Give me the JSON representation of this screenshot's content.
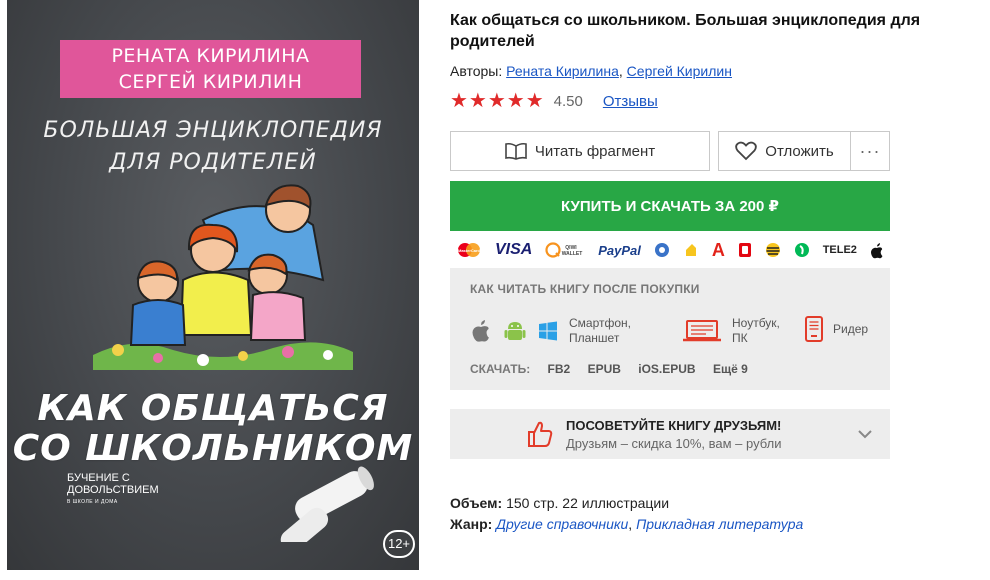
{
  "cover": {
    "author_line_1": "РЕНАТА КИРИЛИНА",
    "author_line_2": "СЕРГЕЙ КИРИЛИН",
    "subtitle_line_1": "БОЛЬШАЯ ЭНЦИКЛОПЕДИЯ",
    "subtitle_line_2": "ДЛЯ РОДИТЕЛЕЙ",
    "title_line_1": "КАК ОБЩАТЬСЯ",
    "title_line_2": "СО ШКОЛЬНИКОМ",
    "series_line_1": "БУЧЕНИЕ С",
    "series_line_2": "ДОВОЛЬСТВИЕМ",
    "series_line_3": "В ШКОЛЕ И ДОМА",
    "age_rating": "12+"
  },
  "book": {
    "title": "Как общаться со школьником. Большая энциклопедия для родителей",
    "authors_label": "Авторы:",
    "author_1": "Рената Кирилина",
    "author_2": "Сергей Кирилин",
    "authors_separator": ",",
    "stars": "★★★★★",
    "rating": "4.50",
    "reviews_label": "Отзывы"
  },
  "actions": {
    "read_fragment": "Читать фрагмент",
    "defer": "Отложить",
    "more": "···",
    "buy": "КУПИТЬ И СКАЧАТЬ ЗА 200 ₽"
  },
  "payments": {
    "mastercard": "MasterCard",
    "visa": "VISA",
    "qiwi": "QIWI WALLET",
    "paypal": "PayPal",
    "tele2": "TELE2"
  },
  "howto": {
    "heading": "КАК ЧИТАТЬ КНИГУ ПОСЛЕ ПОКУПКИ",
    "mobile_line_1": "Смартфон,",
    "mobile_line_2": "Планшет",
    "laptop_line_1": "Ноутбук,",
    "laptop_line_2": "ПК",
    "reader": "Ридер",
    "download_label": "СКАЧАТЬ:",
    "formats": [
      "FB2",
      "EPUB",
      "iOS.EPUB",
      "Ещё 9"
    ]
  },
  "recommend": {
    "title": "ПОСОВЕТУЙТЕ КНИГУ ДРУЗЬЯМ!",
    "subtitle": "Друзьям – скидка 10%, вам – рубли"
  },
  "meta": {
    "volume_label": "Объем:",
    "volume_value": "150 стр. 22 иллюстрации",
    "genre_label": "Жанр:",
    "genre_1": "Другие справочники",
    "genre_separator": ",",
    "genre_2": "Прикладная литература"
  },
  "colors": {
    "buy_green": "#28a745",
    "star_red": "#e02a2a",
    "link_blue": "#1a56c4",
    "cover_pink": "#e0569a",
    "panel_grey": "#ededed"
  }
}
